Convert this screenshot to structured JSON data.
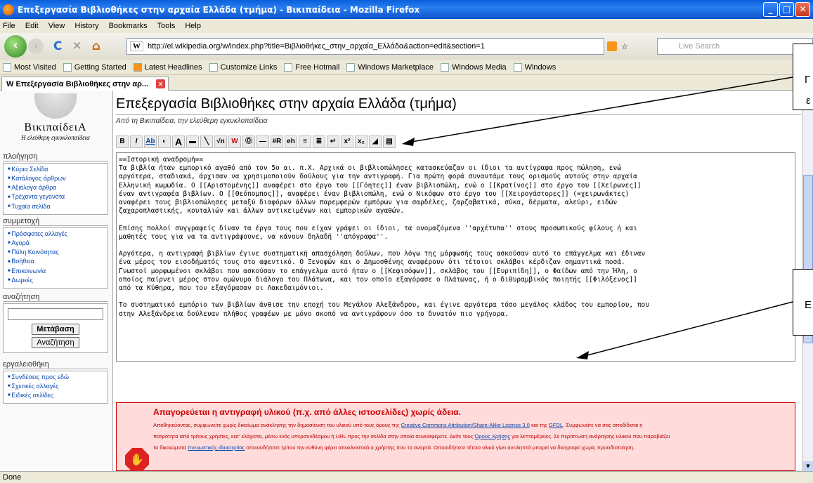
{
  "window": {
    "title": "Επεξεργασία Βιβλιοθήκες στην αρχαία Ελλάδα (τμήμα) - Βικιπαίδεια - Mozilla Firefox",
    "min": "_",
    "max": "□",
    "close": "✕"
  },
  "menu": [
    "File",
    "Edit",
    "View",
    "History",
    "Bookmarks",
    "Tools",
    "Help"
  ],
  "nav": {
    "url": "http://el.wikipedia.org/w/index.php?title=Βιβλιοθήκες_στην_αρχαία_Ελλάδα&action=edit&section=1",
    "search_placeholder": "Live Search",
    "w": "W",
    "back": "‹",
    "fwd": "›",
    "reload": "C",
    "stop": "✕",
    "home": "⌂",
    "star": "☆"
  },
  "bookmarks": [
    "Most Visited",
    "Getting Started",
    "Latest Headlines",
    "Customize Links",
    "Free Hotmail",
    "Windows Marketplace",
    "Windows Media",
    "Windows"
  ],
  "tab": {
    "label": "W Επεξεργασία Βιβλιοθήκες στην αρ...",
    "close": "x"
  },
  "logo": {
    "name": "ΒικιπαίδειΑ",
    "tagline": "Η ελεύθερη εγκυκλοπαίδεια"
  },
  "sidebar": {
    "nav_title": "πλοήγηση",
    "nav": [
      "Κύρια Σελίδα",
      "Κατάλογος άρθρων",
      "Αξιόλογα άρθρα",
      "Τρέχοντα γεγονότα",
      "Τυχαία σελίδα"
    ],
    "part_title": "συμμετοχή",
    "part": [
      "Πρόσφατες αλλαγές",
      "Αγορά",
      "Πύλη Κοινότητας",
      "Βοήθεια",
      "Επικοινωνία",
      "Δωρεές"
    ],
    "search_title": "αναζήτηση",
    "go": "Μετάβαση",
    "search": "Αναζήτηση",
    "tools_title": "εργαλειοθήκη",
    "tools": [
      "Συνδέσεις προς εδώ",
      "Σχετικές αλλαγές",
      "Ειδικές σελίδες"
    ]
  },
  "content": {
    "title": "Επεξεργασία Βιβλιοθήκες στην αρχαία Ελλάδα (τμήμα)",
    "subtitle": "Από τη Βικιπαίδεια, την ελεύθερη εγκυκλοπαίδεια"
  },
  "toolbar": [
    "B",
    "I",
    "Ab",
    "◐",
    "A",
    "▬",
    "╲",
    "√n",
    "W",
    "Ⓞ",
    "—",
    "#R",
    "eh",
    "≡",
    "≣",
    "↵",
    "x²",
    "x₂",
    "◢",
    "▤"
  ],
  "editor_text": "==Ιστορική αναδρομή==\nΤα βιβλία ήταν εμπορικό αγαθό από τον 5ο αι. π.Χ. Αρχικά οι βιβλιοπώλησες κατασκεύαζαν οι ίδιοι τα αντίγραφα προς πώληση, ενώ\nαργότερα, σταδιακά, άρχισαν να χρησιμοποιούν δούλους για την αντιγραφή. Για πρώτη φορά συναντάμε τους ορισμούς αυτούς στην αρχαία\nΕλληνική κωμωδία. Ο [[Αριστομένης]] αναφέρει στο έργο του [[Γόητες]] έναν βιβλιοπώλη, ενώ ο [[Κρατίνος]] στο έργο του [[Χείρωνες]]\nέναν αντιγραφέα βιβλίων. Ο [[Θεόπομπος]], αναφέρει έναν βιβλιοπώλη, ενώ ο Νικόφων στο έργο του [[Χειρογάστορες]] (=χειρωνάκτες)\nαναφέρει τους βιβλιοπώλησες μεταξύ διαφόρων άλλων παρεμφερών εμπόρων για σαρδέλες, ζαρζαβατικά, σύκα, δέρματα, αλεύρι, ειδών\nζαχαροπλαστικής, κουταλιών και άλλων αντικειμένων και εμπορικών αγαθών.\n\nΕπίσης πολλοί συγγραφείς δίναν τα έργα τους που είχαν γράψει οι ίδιοι, τα ονομαζόμενα ''αρχέτυπα'' στους προσωπικούς φίλους ή και\nμαθητές τους για να τα αντιγράψουνε, να κάνουν δηλαδή ''απόγραφα''.\n\nΑργότερα, η αντιγραφή βιβλίων έγινε συστηματική απασχόληση δούλων, που λόγω της μόρφωσής τους ασκούσαν αυτό το επάγγελμα και έδιναν\nένα μέρος του εισοδήματός τους στο αφεντικό. Ο Ξενοφών και ο Δημοσθένης αναφέρουν ότι τέτοιοι σκλάβοι κέρδιζαν σημαντικά ποσά.\nΓνωστοί μορφωμένοι σκλάβοι που ασκούσαν το επάγγελμα αυτό ήταν ο [[Κεφισόφων]], σκλάβος του [[Ευριπίδη]], ο Φαίδων από την Ήλη, ο\nοποίος παίρνει μέρος στον ομώνυμο διάλογο του Πλάτωνα, και τον οποίο εξαγόρασε ο Πλάτωνας, ή ο διθυραμβικός ποιητής [[Φιλόξενος]]\nαπό τα Κύθηρα, που τον εξαγόρασαν οι Λακεδαιμόνιοι.\n\nΤο συστηματικό εμπόριο των βιβλίων άνθισε την εποχή του Μεγάλου Αλεξάνδρου, και έγινε αργότερα τόσο μεγάλος κλάδος του εμπορίου, που\nστην Αλεξάνδρεια δούλευαν πλήθος γραφέων με μόνο σκοπό να αντιγράφουν όσο το δυνατόν πιο γρήγορα.",
  "warning": {
    "title": "Απαγορεύεται η αντιγραφή υλικού (π.χ. από άλλες ιστοσελίδες) χωρίς άδεια.",
    "line1": "Αποθηκεύοντας, συμφωνείτε χωρίς δικαίωμα ανάκλησης την δημοσίευση του υλικού υπό τους όρους της",
    "link1": "Creative Commons Attribution/Share-Alike License 3.0",
    "and": "και της",
    "link2": "GFDL",
    "line1b": ". Συμφωνείτε να σας αποδίδεται η",
    "line2": "πατρότητα από τρίτους χρήστες, κατ' ελάχιστο, μέσω ενός υπερσυνδέσμου ή URL προς την σελίδα στην οποία συνεισφέρετε. Δείτε τους",
    "link3": "Όρους Χρήσης",
    "line2b": "για λεπτομέρειες. Σε περίπτωση ανάρτησης υλικού που παραβιάζει",
    "line3a": "τα δικαιώματα",
    "link4": "πνευματικής ιδιοκτησίας",
    "line3b": "οποιουδήποτε τρίτου την ευθύνη φέρει αποκλειστικά ο χρήστης που το αναρτά. Οποιοδήποτε τέτοιο υλικό γίνει αντιληπτό μπορεί να διαγραφεί χωρίς προειδοποίηση."
  },
  "callouts": [
    "Γ",
    "ε",
    "Ε"
  ],
  "status": "Done"
}
